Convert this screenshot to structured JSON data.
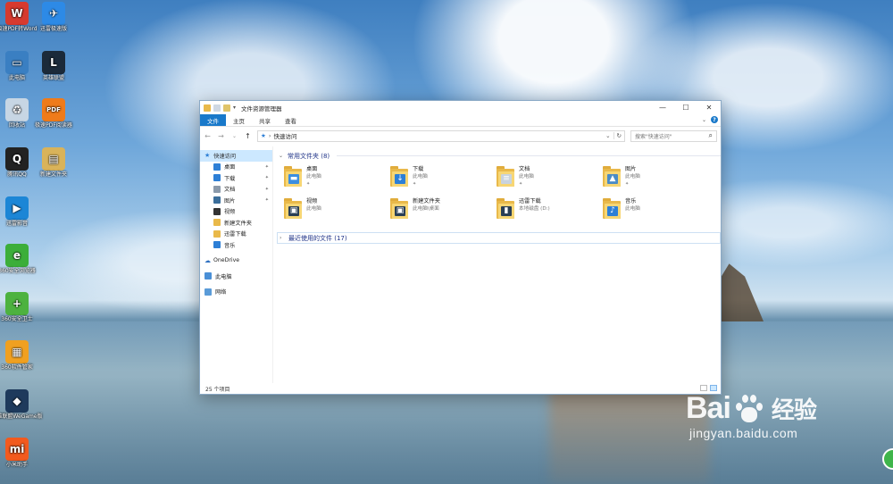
{
  "desktop": {
    "icons": [
      {
        "label": "极速PDF转Word",
        "icon": "pdf-to-word-icon",
        "color": "#d63a2f",
        "glyph": "W"
      },
      {
        "label": "迅雷极速版",
        "icon": "thunder-icon",
        "color": "#2d8ae6",
        "glyph": "✈"
      },
      {
        "label": "此电脑",
        "icon": "computer-icon",
        "color": "#3a7fc2",
        "glyph": "▭"
      },
      {
        "label": "英雄联盟",
        "icon": "league-icon",
        "color": "#1b2a3a",
        "glyph": "L"
      },
      {
        "label": "回收站",
        "icon": "recycle-bin-icon",
        "color": "#c7d6e4",
        "glyph": "♻"
      },
      {
        "label": "极速PDF阅读器",
        "icon": "pdf-reader-icon",
        "color": "#ef7b1a",
        "glyph": "PDF"
      },
      {
        "label": "腾讯QQ",
        "icon": "qq-icon",
        "color": "#222222",
        "glyph": "Q"
      },
      {
        "label": "新建文件夹",
        "icon": "folder-icon",
        "color": "#d9b35a",
        "glyph": "▤"
      },
      {
        "label": "迅雷影音",
        "icon": "thunder-player-icon",
        "color": "#1c86d6",
        "glyph": "▶"
      },
      {
        "label": "360安全浏览器",
        "icon": "360-browser-icon",
        "color": "#3cae3a",
        "glyph": "e"
      },
      {
        "label": "360安全卫士",
        "icon": "360-safe-icon",
        "color": "#4db23f",
        "glyph": "+"
      },
      {
        "label": "360软件管家",
        "icon": "360-software-icon",
        "color": "#f0a020",
        "glyph": "▦"
      },
      {
        "label": "英雄联盟WeGame版",
        "icon": "wegame-icon",
        "color": "#1e3a5c",
        "glyph": "◆"
      },
      {
        "label": "小米助手",
        "icon": "mi-icon",
        "color": "#f25a1e",
        "glyph": "mi"
      }
    ]
  },
  "window": {
    "title": "文件资源管理器",
    "controls": {
      "minimize": "—",
      "maximize": "☐",
      "close": "✕"
    },
    "ribbon_tabs": [
      "文件",
      "主页",
      "共享",
      "查看"
    ],
    "address": {
      "location": "快速访问",
      "back": "←",
      "forward": "→",
      "up": "↑",
      "dropdown": "⌄",
      "refresh": "↻"
    },
    "search": {
      "placeholder": "搜索\"快速访问\"",
      "icon": "⌕"
    },
    "nav": {
      "quick_access": "快速访问",
      "pinned": [
        {
          "label": "桌面",
          "color": "#2d7fd6",
          "pinned": true
        },
        {
          "label": "下载",
          "color": "#2d7fd6",
          "pinned": true
        },
        {
          "label": "文档",
          "color": "#8b9aab",
          "pinned": true
        },
        {
          "label": "图片",
          "color": "#3b6e9b",
          "pinned": true
        },
        {
          "label": "视频",
          "color": "#333333",
          "pinned": false
        },
        {
          "label": "新建文件夹",
          "color": "#e9b94a",
          "pinned": false
        },
        {
          "label": "迅雷下载",
          "color": "#e9b94a",
          "pinned": false
        },
        {
          "label": "音乐",
          "color": "#2d7fd6",
          "pinned": false
        }
      ],
      "onedrive": "OneDrive",
      "this_pc": "此电脑",
      "network": "网络"
    },
    "groups": {
      "frequent": {
        "title": "常用文件夹 (8)",
        "chevron": "⌄"
      },
      "recent": {
        "title": "最近使用的文件 (17)",
        "chevron": "›"
      }
    },
    "folders": [
      {
        "name": "桌面",
        "location": "此电脑",
        "pinned": true,
        "badge": "#3c8ee0",
        "glyph": "▬"
      },
      {
        "name": "下载",
        "location": "此电脑",
        "pinned": true,
        "badge": "#2d7fd6",
        "glyph": "↓"
      },
      {
        "name": "文档",
        "location": "此电脑",
        "pinned": true,
        "badge": "#c9d3de",
        "glyph": "≡"
      },
      {
        "name": "图片",
        "location": "此电脑",
        "pinned": true,
        "badge": "#4a8bc6",
        "glyph": "▲"
      },
      {
        "name": "视频",
        "location": "此电脑",
        "pinned": false,
        "badge": "#2a3f55",
        "glyph": "▣"
      },
      {
        "name": "新建文件夹",
        "location": "此电脑\\桌面",
        "pinned": false,
        "badge": "#2a3f55",
        "glyph": "▣"
      },
      {
        "name": "迅雷下载",
        "location": "本地磁盘 (D:)",
        "pinned": false,
        "badge": "#2a3f55",
        "glyph": "▮"
      },
      {
        "name": "音乐",
        "location": "此电脑",
        "pinned": false,
        "badge": "#2d7fd6",
        "glyph": "♪"
      }
    ],
    "pin_glyph": "📌",
    "status": "25 个项目"
  },
  "watermark": {
    "brand_left": "Bai",
    "brand_right": "经验",
    "url": "jingyan.baidu.com"
  }
}
